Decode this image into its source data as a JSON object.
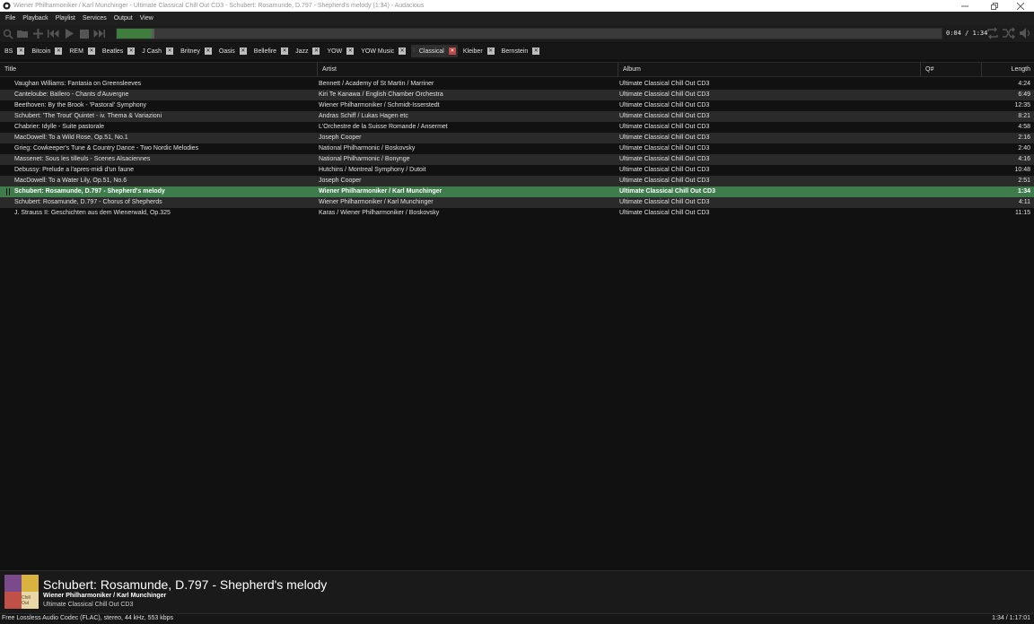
{
  "window": {
    "title": "Wiener Philharmoniker / Karl Munchinger - Ultimate Classical Chill Out CD3 - Schubert: Rosamunde, D.797 - Shepherd's melody (1:34) - Audacious",
    "controls": [
      "minimize-icon",
      "restore-icon",
      "close-icon"
    ]
  },
  "menu": [
    "File",
    "Playback",
    "Playlist",
    "Services",
    "Output",
    "View"
  ],
  "toolbar": {
    "buttons": [
      "search-icon",
      "open-folder-icon",
      "add-icon",
      "previous-icon",
      "play-icon",
      "stop-icon",
      "next-icon"
    ],
    "time": "0:04 / 1:34",
    "progress_fraction": 0.0426,
    "right_buttons": [
      "repeat-icon",
      "shuffle-icon",
      "volume-icon"
    ],
    "accent": "#3f7d3f"
  },
  "playlists": [
    {
      "label": "BS",
      "active": false
    },
    {
      "label": "Bitcoin",
      "active": false
    },
    {
      "label": "REM",
      "active": false
    },
    {
      "label": "Beatles",
      "active": false
    },
    {
      "label": "J Cash",
      "active": false
    },
    {
      "label": "Britney",
      "active": false
    },
    {
      "label": "Oasis",
      "active": false
    },
    {
      "label": "Bellefire",
      "active": false
    },
    {
      "label": "Jazz",
      "active": false
    },
    {
      "label": "YOW",
      "active": false
    },
    {
      "label": "YOW Music",
      "active": false
    },
    {
      "label": "Classical",
      "active": true
    },
    {
      "label": "Kleiber",
      "active": false
    },
    {
      "label": "Bernstein",
      "active": false
    }
  ],
  "columns": {
    "title": "Title",
    "artist": "Artist",
    "album": "Album",
    "queue": "Q#",
    "length": "Length"
  },
  "tracks": [
    {
      "title": "Vaughan Williams: Fantasia on Greensleeves",
      "artist": "Bennett / Academy of St Martin / Marriner",
      "album": "Ultimate Classical Chill Out CD3",
      "length": "4:24"
    },
    {
      "title": "Canteloube: Baïlero - Chants d'Auvergne",
      "artist": "Kiri Te Kanawa / English Chamber Orchestra",
      "album": "Ultimate Classical Chill Out CD3",
      "length": "6:49"
    },
    {
      "title": "Beethoven: By the Brook - 'Pastoral' Symphony",
      "artist": "Wiener Philharmoniker / Schmidt-Isserstedt",
      "album": "Ultimate Classical Chill Out CD3",
      "length": "12:35"
    },
    {
      "title": "Schubert: 'The Trout' Quintet - iv. Thema & Variazioni",
      "artist": "Andras Schiff / Lukas Hagen etc",
      "album": "Ultimate Classical Chill Out CD3",
      "length": "8:21"
    },
    {
      "title": "Chabrier: Idylle - Suite pastorale",
      "artist": "L'Orchestre de la Suisse Romande / Ansermet",
      "album": "Ultimate Classical Chill Out CD3",
      "length": "4:58"
    },
    {
      "title": "MacDowell: To a Wild Rose, Op.51, No.1",
      "artist": "Joseph Cooper",
      "album": "Ultimate Classical Chill Out CD3",
      "length": "2:16"
    },
    {
      "title": "Grieg: Cowkeeper's Tune & Country Dance - Two Nordic Melodies",
      "artist": "National Philharmonic / Boskovsky",
      "album": "Ultimate Classical Chill Out CD3",
      "length": "2:40"
    },
    {
      "title": "Massenet: Sous les tilleuls - Scenes Alsaciennes",
      "artist": "National Philharmonic / Bonynge",
      "album": "Ultimate Classical Chill Out CD3",
      "length": "4:16"
    },
    {
      "title": "Debussy: Prelude a l'apres-midi d'un faune",
      "artist": "Hutchins / Montreal Symphony / Dutoit",
      "album": "Ultimate Classical Chill Out CD3",
      "length": "10:48"
    },
    {
      "title": "MacDowell: To a Water Lily, Op.51, No.6",
      "artist": "Joseph Cooper",
      "album": "Ultimate Classical Chill Out CD3",
      "length": "2:51"
    },
    {
      "title": "Schubert: Rosamunde, D.797 - Shepherd's melody",
      "artist": "Wiener Philharmoniker / Karl Munchinger",
      "album": "Ultimate Classical Chill Out CD3",
      "length": "1:34",
      "current": true
    },
    {
      "title": "Schubert: Rosamunde, D.797 - Chorus of Shepherds",
      "artist": "Wiener Philharmoniker / Karl Munchinger",
      "album": "Ultimate Classical Chill Out CD3",
      "length": "4:11"
    },
    {
      "title": "J. Strauss II: Geschichten aus dem Wienerwald, Op.325",
      "artist": "Karas / Wiener Philharmoniker / Boskovsky",
      "album": "Ultimate Classical Chill Out CD3",
      "length": "11:15"
    }
  ],
  "now_playing": {
    "title": "Schubert: Rosamunde, D.797 - Shepherd's melody",
    "artist": "Wiener Philharmoniker / Karl Munchinger",
    "album": "Ultimate Classical Chill Out CD3",
    "art_lettering": "Chill Out"
  },
  "status": {
    "codec": "Free Lossless Audio Codec (FLAC), stereo, 44 kHz, 553 kbps",
    "position": "1:34 / 1:17:01"
  }
}
